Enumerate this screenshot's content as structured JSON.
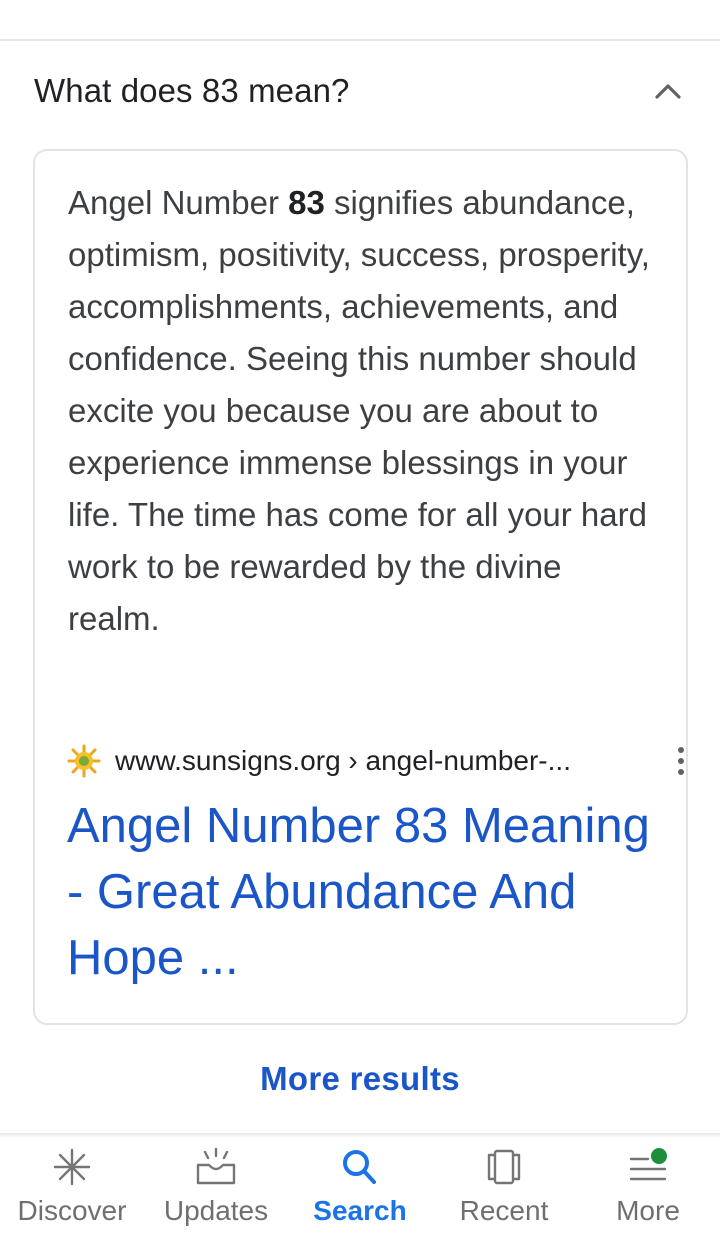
{
  "faq": {
    "question": "What does 83 mean?"
  },
  "snippet": {
    "before": "Angel Number ",
    "bold": "83",
    "after": " signifies abundance, optimism, positivity, success, prosperity, accomplishments, achievements, and confidence. Seeing this number should excite you because you are about to experience immense blessings in your life. The time has come for all your hard work to be rewarded by the divine realm."
  },
  "result": {
    "url": "www.sunsigns.org › angel-number-...",
    "title": "Angel Number 83 Meaning - Great Abundance And Hope ..."
  },
  "more_results": "More results",
  "bottom_nav": {
    "items": [
      {
        "label": "Discover",
        "icon": "asterisk-icon"
      },
      {
        "label": "Updates",
        "icon": "inbox-updates-icon"
      },
      {
        "label": "Search",
        "icon": "search-icon",
        "active": true
      },
      {
        "label": "Recent",
        "icon": "cards-icon"
      },
      {
        "label": "More",
        "icon": "menu-icon",
        "badge": true
      }
    ]
  },
  "colors": {
    "link": "#1a56c8",
    "active_nav": "#1a73e8",
    "badge": "#1e8e3e"
  }
}
